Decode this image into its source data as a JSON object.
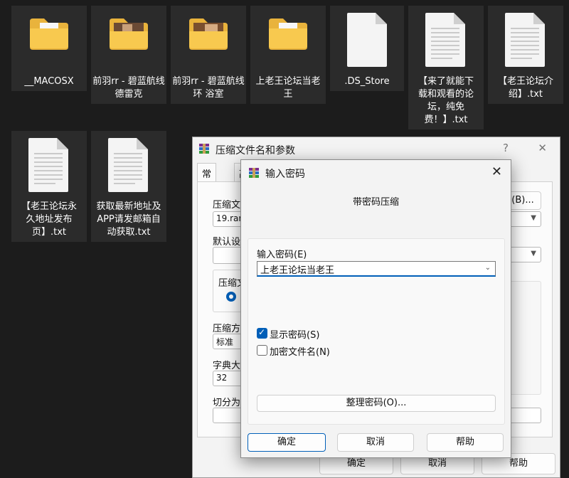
{
  "files": [
    {
      "name": "__MACOSX",
      "type": "folder",
      "preview": false
    },
    {
      "name": "前羽rr - 碧蓝航线 德雷克",
      "type": "folder",
      "preview": true
    },
    {
      "name": "前羽rr - 碧蓝航线 环 浴室",
      "type": "folder",
      "preview": true
    },
    {
      "name": "上老王论坛当老王",
      "type": "folder",
      "preview": false
    },
    {
      "name": ".DS_Store",
      "type": "file"
    },
    {
      "name": "【来了就能下载和观看的论坛，纯免费！】.txt",
      "type": "text"
    },
    {
      "name": "【老王论坛介绍】.txt",
      "type": "text"
    },
    {
      "name": "【老王论坛永久地址发布页】.txt",
      "type": "text"
    },
    {
      "name": "获取最新地址及APP请发邮箱自动获取.txt",
      "type": "text"
    }
  ],
  "archive_dialog": {
    "title": "压缩文件名和参数",
    "help_glyph": "?",
    "close_glyph": "✕",
    "tab_general": "常规",
    "tab_advanced_partial": "高",
    "archive_name_label": "压缩文件",
    "archive_name_value": "19.rar",
    "browse_button": "(B)...",
    "default_settings_label": "默认设置",
    "format_label": "压缩文",
    "method_label": "压缩方式",
    "method_value": "标准",
    "dict_label": "字典大小",
    "dict_value": "32",
    "split_label": "切分为分卷",
    "ok_button": "确定",
    "cancel_button": "取消",
    "help_button": "帮助"
  },
  "password_dialog": {
    "title": "输入密码",
    "close_glyph": "✕",
    "heading": "带密码压缩",
    "password_label": "输入密码(E)",
    "password_value": "上老王论坛当老王",
    "show_password_label": "显示密码(S)",
    "show_password_checked": true,
    "encrypt_names_label": "加密文件名(N)",
    "encrypt_names_checked": false,
    "organize_button": "整理密码(O)...",
    "ok_button": "确定",
    "cancel_button": "取消",
    "help_button": "帮助",
    "accent_color": "#005fb8"
  },
  "icons": {
    "folder": "folder-icon",
    "document": "document-icon",
    "text_document": "text-document-icon",
    "app": "winrar-icon",
    "dropdown": "chevron-down-icon",
    "checkmark": "checkmark-icon"
  }
}
